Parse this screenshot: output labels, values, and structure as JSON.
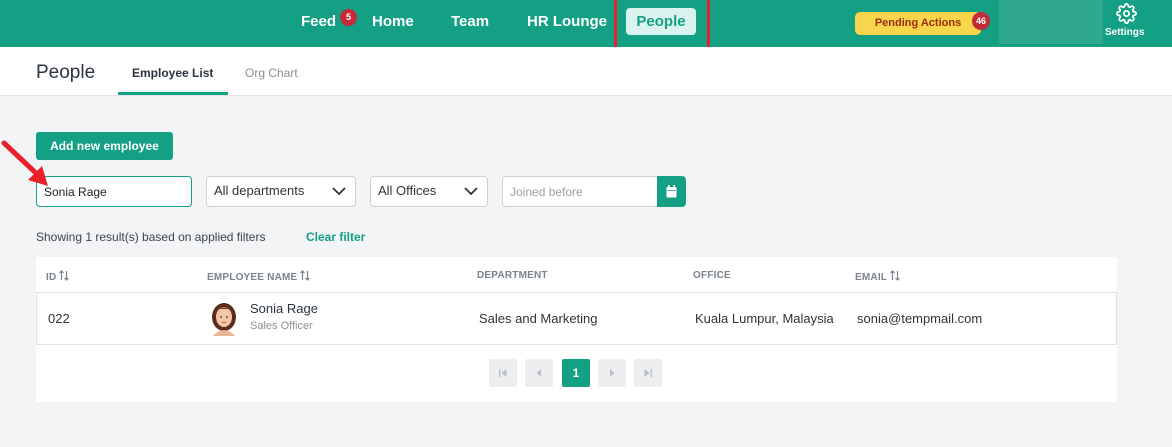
{
  "nav": {
    "feed": "Feed",
    "feed_badge": "5",
    "home": "Home",
    "team": "Team",
    "hr_lounge": "HR Lounge",
    "people": "People",
    "pending_actions": "Pending Actions",
    "pending_badge": "46",
    "settings": "Settings"
  },
  "header": {
    "title": "People",
    "tabs": [
      {
        "label": "Employee List",
        "active": true
      },
      {
        "label": "Org Chart",
        "active": false
      }
    ]
  },
  "controls": {
    "add_button": "Add new employee",
    "search_value": "Sonia Rage",
    "department_select": "All departments",
    "office_select": "All Offices",
    "joined_placeholder": "Joined before"
  },
  "results": {
    "summary": "Showing 1 result(s) based on applied filters",
    "clear_filter": "Clear filter"
  },
  "table": {
    "columns": {
      "id": "ID",
      "name": "EMPLOYEE NAME",
      "department": "DEPARTMENT",
      "office": "OFFICE",
      "email": "EMAIL"
    },
    "rows": [
      {
        "id": "022",
        "name": "Sonia Rage",
        "role": "Sales Officer",
        "department": "Sales and Marketing",
        "office": "Kuala Lumpur, Malaysia",
        "email": "sonia@tempmail.com"
      }
    ]
  },
  "pagination": {
    "current_page": "1"
  },
  "colors": {
    "brand": "#13a084",
    "badge": "#c52a3a",
    "pending": "#f8d54a",
    "annotation": "#e8202a"
  },
  "icons": [
    "settings-gear-icon",
    "chevron-down-icon",
    "calendar-icon",
    "sort-icon",
    "first-page-icon",
    "prev-page-icon",
    "next-page-icon",
    "last-page-icon"
  ]
}
